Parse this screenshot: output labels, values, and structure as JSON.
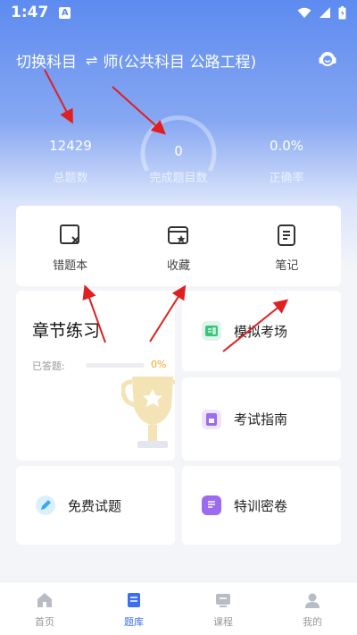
{
  "status_bar": {
    "time": "1:47",
    "notification": "A"
  },
  "header": {
    "switch_label": "切换科目",
    "switch_icon": "⇌",
    "subject_title": "师(公共科目 公路工程)",
    "service_icon": "headset-icon"
  },
  "stats": {
    "total": {
      "value": "12429",
      "label": "总题数"
    },
    "completed": {
      "value": "0",
      "label": "完成题目数"
    },
    "accuracy": {
      "value": "0.0%",
      "label": "正确率"
    }
  },
  "quick_actions": [
    {
      "label": "错题本",
      "icon": "wrong-book-icon"
    },
    {
      "label": "收藏",
      "icon": "favorite-icon"
    },
    {
      "label": "笔记",
      "icon": "note-icon"
    }
  ],
  "chapter": {
    "title": "章节练习",
    "progress_label": "已答题:",
    "progress_percent": "0%",
    "progress_fraction": 0
  },
  "cards": {
    "mock_exam": {
      "label": "模拟考场",
      "icon": "exam-icon",
      "color": "#3cc47c"
    },
    "exam_guide": {
      "label": "考试指南",
      "icon": "guide-icon",
      "color": "#9b6bf0"
    },
    "free_questions": {
      "label": "免费试题",
      "icon": "pencil-icon",
      "color": "#3aa8f5"
    },
    "special_training": {
      "label": "特训密卷",
      "icon": "document-icon",
      "color": "#9b6bf0"
    }
  },
  "bottom_nav": [
    {
      "label": "首页",
      "icon": "home-icon"
    },
    {
      "label": "题库",
      "icon": "question-bank-icon",
      "active": true
    },
    {
      "label": "课程",
      "icon": "course-icon"
    },
    {
      "label": "我的",
      "icon": "user-icon"
    }
  ],
  "colors": {
    "accent": "#3b6ef5",
    "hero_top": "#5d8bf0",
    "progress": "#f5a623",
    "annotation": "#e02020"
  }
}
